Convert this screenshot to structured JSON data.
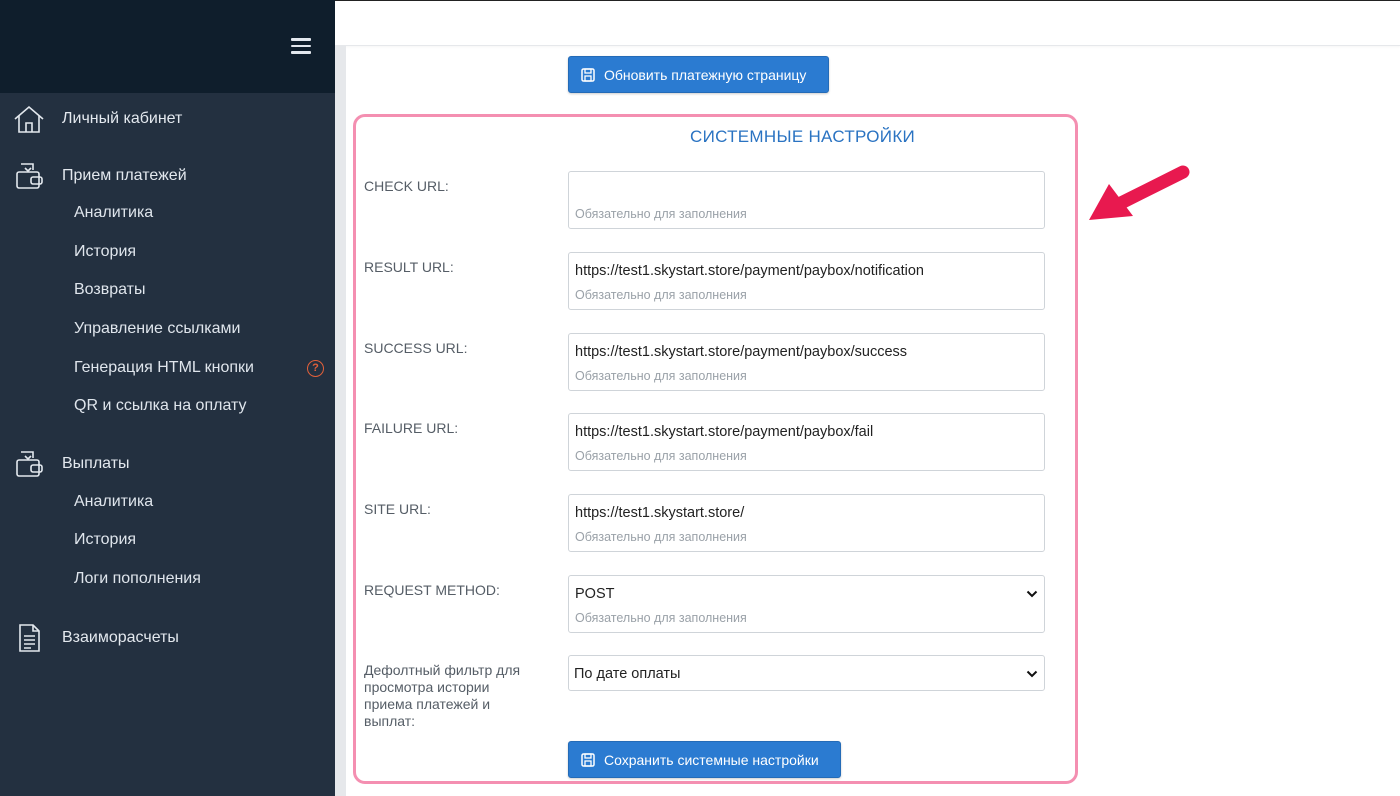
{
  "sidebar": {
    "cabinet": "Личный кабинет",
    "payments": {
      "label": "Прием платежей",
      "items": [
        "Аналитика",
        "История",
        "Возвраты",
        "Управление ссылками",
        "Генерация HTML кнопки",
        "QR и ссылка на оплату"
      ]
    },
    "payouts": {
      "label": "Выплаты",
      "items": [
        "Аналитика",
        "История",
        "Логи пополнения"
      ]
    },
    "settlements": "Взаиморасчеты",
    "help_glyph": "?"
  },
  "main": {
    "update_button": "Обновить платежную страницу",
    "panel_title": "СИСТЕМНЫЕ НАСТРОЙКИ",
    "placeholder": "Обязательно для заполнения",
    "fields": [
      {
        "label": "CHECK URL:",
        "value": ""
      },
      {
        "label": "RESULT URL:",
        "value": "https://test1.skystart.store/payment/paybox/notification"
      },
      {
        "label": "SUCCESS URL:",
        "value": "https://test1.skystart.store/payment/paybox/success"
      },
      {
        "label": "FAILURE URL:",
        "value": "https://test1.skystart.store/payment/paybox/fail"
      },
      {
        "label": "SITE URL:",
        "value": "https://test1.skystart.store/"
      }
    ],
    "request_method": {
      "label": "REQUEST METHOD:",
      "value": "POST"
    },
    "default_filter": {
      "label": "Дефолтный фильтр для просмотра истории приема платежей и выплат:",
      "value": "По дате оплаты"
    },
    "save_button": "Сохранить системные настройки"
  },
  "colors": {
    "sidebar": "#233040",
    "sidebar_head": "#0f1e2c",
    "accent": "#2b7bd1",
    "panel_border": "#f48fb1",
    "arrow": "#e8194f"
  }
}
